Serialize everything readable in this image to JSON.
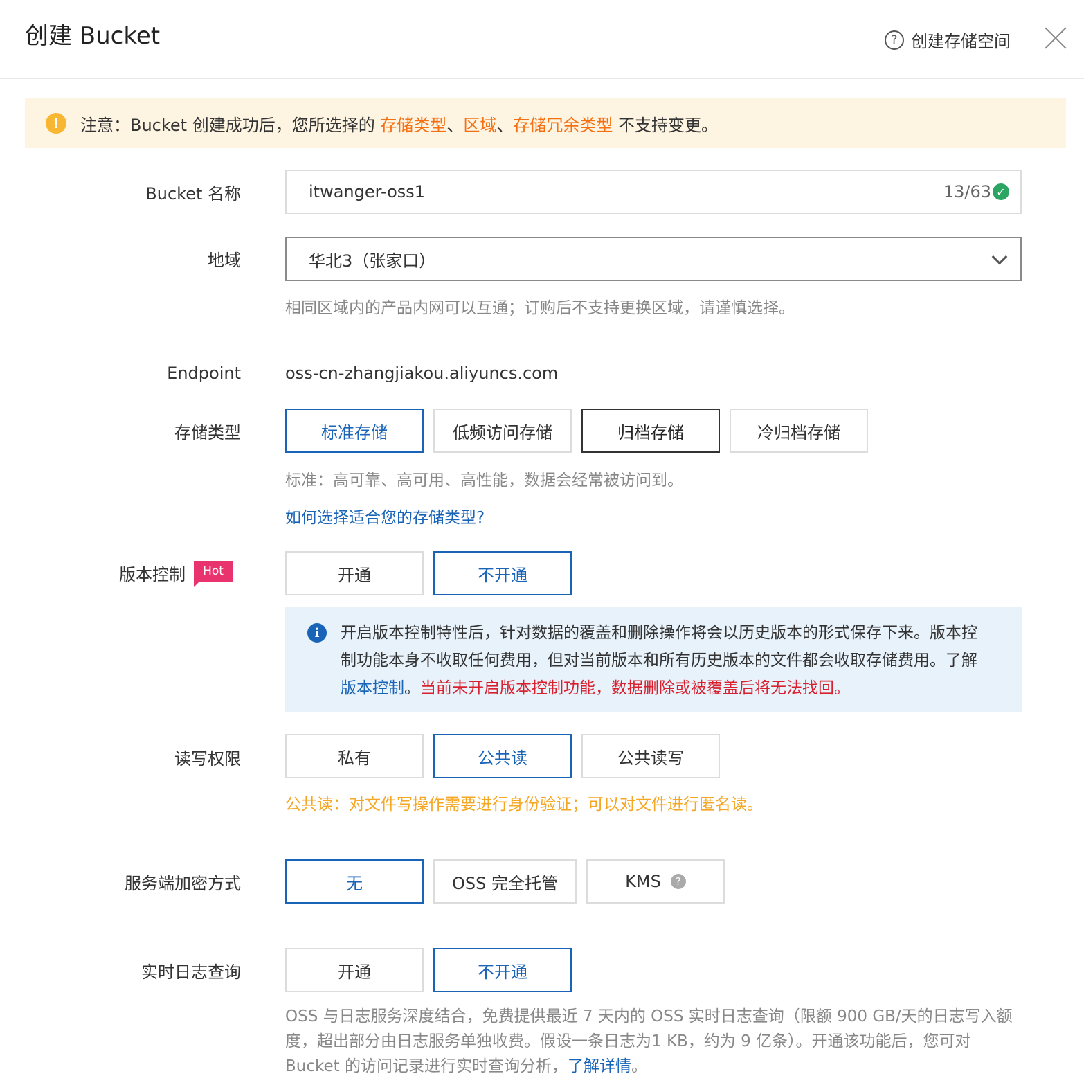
{
  "header": {
    "title": "创建 Bucket",
    "help_icon": "?",
    "help_label": "创建存储空间",
    "close_icon": "close-icon"
  },
  "notice": {
    "icon": "!",
    "prefix": "注意：Bucket 创建成功后，您所选择的 ",
    "highlight1": "存储类型",
    "sep1": "、",
    "highlight2": "区域",
    "sep2": "、",
    "highlight3": "存储冗余类型",
    "suffix": " 不支持变更。"
  },
  "bucket_name": {
    "label": "Bucket 名称",
    "value": "itwanger-oss1",
    "counter": "13/63",
    "check": "✓"
  },
  "region": {
    "label": "地域",
    "value": "华北3（张家口）",
    "hint": "相同区域内的产品内网可以互通；订购后不支持更换区域，请谨慎选择。"
  },
  "endpoint": {
    "label": "Endpoint",
    "value": "oss-cn-zhangjiakou.aliyuncs.com"
  },
  "storage_type": {
    "label": "存储类型",
    "options": [
      "标准存储",
      "低频访问存储",
      "归档存储",
      "冷归档存储"
    ],
    "selected": "标准存储",
    "hint": "标准：高可靠、高可用、高性能，数据会经常被访问到。",
    "link": "如何选择适合您的存储类型?"
  },
  "versioning": {
    "label": "版本控制",
    "badge": "Hot",
    "options": [
      "开通",
      "不开通"
    ],
    "selected": "不开通",
    "info_icon": "i",
    "info_text": "开启版本控制特性后，针对数据的覆盖和删除操作将会以历史版本的形式保存下来。版本控制功能本身不收取任何费用，但对当前版本和所有历史版本的文件都会收取存储费用。了解 ",
    "info_link": "版本控制",
    "info_dot": "。",
    "info_warning": "当前未开启版本控制功能，数据删除或被覆盖后将无法找回。"
  },
  "acl": {
    "label": "读写权限",
    "options": [
      "私有",
      "公共读",
      "公共读写"
    ],
    "selected": "公共读",
    "hint": "公共读：对文件写操作需要进行身份验证；可以对文件进行匿名读。"
  },
  "encryption": {
    "label": "服务端加密方式",
    "options": [
      "无",
      "OSS 完全托管",
      "KMS"
    ],
    "selected": "无",
    "kms_help_icon": "?"
  },
  "realtime_log": {
    "label": "实时日志查询",
    "options": [
      "开通",
      "不开通"
    ],
    "selected": "不开通",
    "hint": "OSS 与日志服务深度结合，免费提供最近 7 天内的 OSS 实时日志查询（限额 900 GB/天的日志写入额度，超出部分由日志服务单独收费。假设一条日志为1 KB，约为 9 亿条）。开通该功能后，您可对 Bucket 的访问记录进行实时查询分析，",
    "link": "了解详情",
    "hint_end": "。"
  },
  "colors": {
    "accent": "#1a64b8",
    "orange": "#f57012",
    "warning_text": "#f5a623",
    "danger": "#d9202e",
    "badge": "#e8336e",
    "notice_bg": "#fdf4e2",
    "info_bg": "#e8f2fb"
  }
}
